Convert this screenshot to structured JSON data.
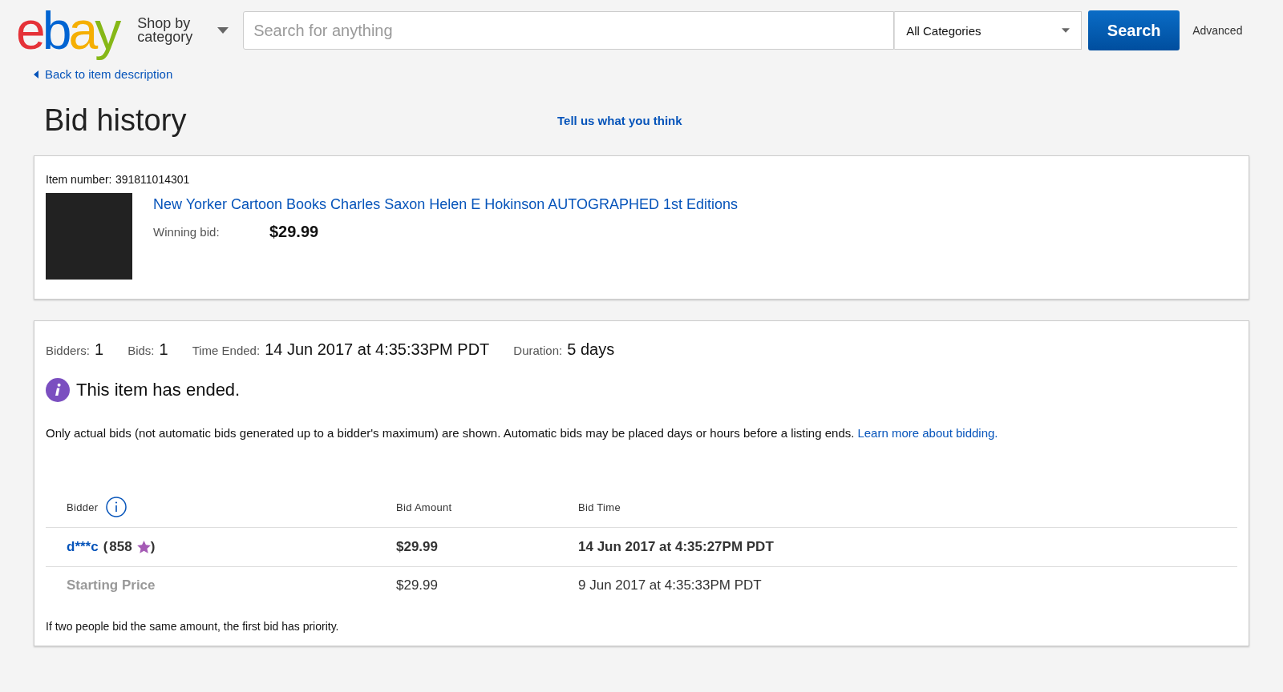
{
  "header": {
    "logo": "ebay",
    "shop_by": "Shop by category",
    "search": {
      "placeholder": "Search for anything"
    },
    "category_select": "All Categories",
    "search_button": "Search",
    "advanced": "Advanced"
  },
  "back_link": "Back to item description",
  "title": "Bid history",
  "feedback_link": "Tell us what you think",
  "item": {
    "number_label": "Item number:",
    "number": "391811014301",
    "title": "New Yorker Cartoon Books Charles Saxon Helen E Hokinson AUTOGRAPHED 1st Editions",
    "winning_label": "Winning bid:",
    "winning_bid": "$29.99"
  },
  "summary": [
    {
      "label": "Bidders:",
      "value": "1"
    },
    {
      "label": "Bids:",
      "value": "1"
    },
    {
      "label": "Time Ended:",
      "value": "14 Jun 2017 at 4:35:33PM PDT"
    },
    {
      "label": "Duration:",
      "value": "5 days"
    }
  ],
  "status": "This item has ended.",
  "note": "Only actual bids (not automatic bids generated up to a bidder's maximum) are shown. Automatic bids may be placed days or hours before a listing ends.",
  "note_link": "Learn more about bidding.",
  "table": {
    "columns": [
      "Bidder",
      "Bid Amount",
      "Bid Time"
    ],
    "rows": [
      {
        "kind": "bid",
        "bidder": "d***c",
        "score": "858",
        "open": "(",
        "close": ")",
        "amount": "$29.99",
        "time": "14 Jun 2017 at 4:35:27PM PDT"
      },
      {
        "kind": "start",
        "bidder": "Starting Price",
        "amount": "$29.99",
        "time": "9 Jun 2017 at 4:35:33PM PDT"
      }
    ]
  },
  "footnote": "If two people bid the same amount, the first bid has priority."
}
